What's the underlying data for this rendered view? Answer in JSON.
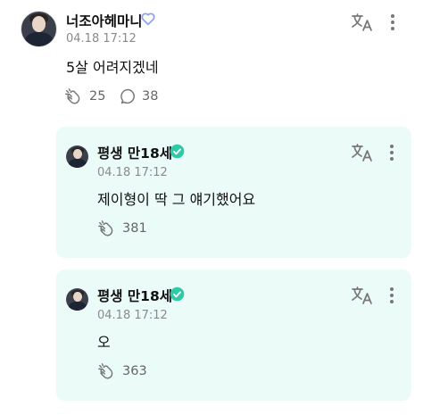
{
  "post": {
    "author": "너조아헤마니",
    "author_icon": "heart-outline-icon",
    "timestamp": "04.18 17:12",
    "text": "5살 어려지겠네",
    "reaction_count": "25",
    "comment_count": "38"
  },
  "replies": [
    {
      "author": "평생 만18세",
      "badge_icon": "verified-badge-icon",
      "timestamp": "04.18 17:12",
      "text": "제이형이 딱 그 얘기했어요",
      "reaction_count": "381"
    },
    {
      "author": "평생 만18세",
      "badge_icon": "verified-badge-icon",
      "timestamp": "04.18 17:12",
      "text": "오",
      "reaction_count": "363"
    }
  ],
  "colors": {
    "reply_background": "#ebfbf8",
    "badge": "#2fc9a6",
    "heart_outline": "#8aa6ea",
    "icon_gray": "#777777"
  }
}
